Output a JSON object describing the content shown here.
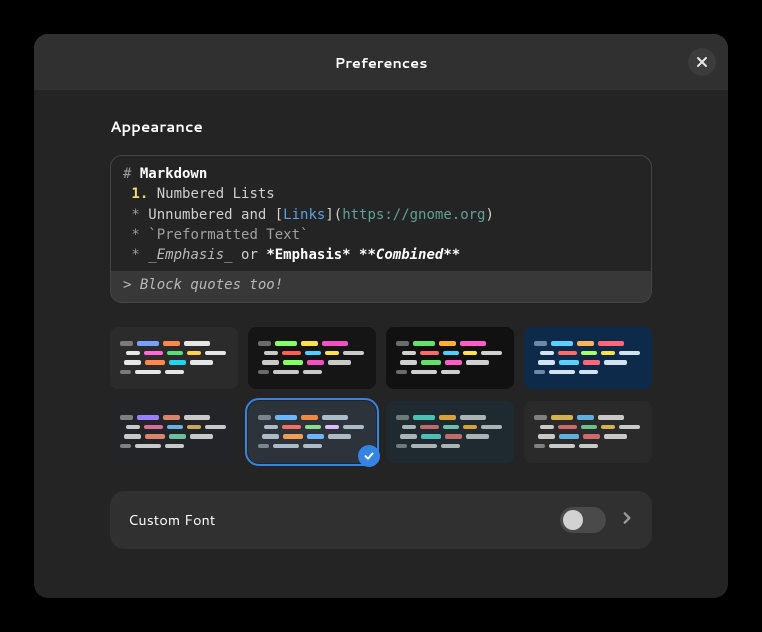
{
  "header": {
    "title": "Preferences"
  },
  "section": {
    "title": "Appearance"
  },
  "preview": {
    "heading_marker": "# ",
    "heading_text": "Markdown",
    "line_num_marker": " 1.",
    "line_num_text": " Numbered Lists",
    "unnum_marker": " * ",
    "unnum_text": "Unnumbered and ",
    "link_open": "[",
    "link_text": "Links",
    "link_mid": "](",
    "link_url": "https://gnome.org",
    "link_close": ")",
    "pre_marker": " * ",
    "pre_text": "`Preformatted Text`",
    "emph_marker": " * ",
    "emph1": "_Emphasis_",
    "emph_or": " or ",
    "emph2": "*Emphasis*",
    "emph_space": " ",
    "emph3": "**Combined**",
    "blockquote": "> Block quotes too!"
  },
  "themes": [
    {
      "id": "theme-1",
      "bg": "#2b2b2b",
      "selected": false,
      "colors": [
        [
          "#7a7a7a",
          "#7aa0ff",
          "#ff884d",
          "#e6e6e6"
        ],
        [
          "#e6e6e6",
          "#ff6ad5",
          "#55e07a",
          "#ffd24d",
          "#e6e6e6"
        ],
        [
          "#e6e6e6",
          "#ff884d",
          "#22d3ee",
          "#e6e6e6"
        ],
        [
          "#7a7a7a",
          "#e6e6e6",
          "#e6e6e6"
        ]
      ]
    },
    {
      "id": "theme-2",
      "bg": "#151515",
      "selected": false,
      "colors": [
        [
          "#6b6b6b",
          "#85ff66",
          "#ffe14d",
          "#f050c0"
        ],
        [
          "#c9c9c9",
          "#ff6050",
          "#4dd0ff",
          "#ffe14d",
          "#c9c9c9"
        ],
        [
          "#c9c9c9",
          "#85ff66",
          "#f050c0",
          "#c9c9c9"
        ],
        [
          "#6b6b6b",
          "#c9c9c9",
          "#c9c9c9"
        ]
      ]
    },
    {
      "id": "theme-3",
      "bg": "#111111",
      "selected": false,
      "colors": [
        [
          "#6b6b6b",
          "#62e06b",
          "#ffb02e",
          "#ff5cc8"
        ],
        [
          "#d0d0d0",
          "#ff6a6a",
          "#4dd0ff",
          "#ffe14d",
          "#d0d0d0"
        ],
        [
          "#d0d0d0",
          "#62e06b",
          "#ff5cc8",
          "#d0d0d0"
        ],
        [
          "#6b6b6b",
          "#d0d0d0",
          "#d0d0d0"
        ]
      ]
    },
    {
      "id": "theme-4",
      "bg": "#0d2a4a",
      "selected": false,
      "colors": [
        [
          "#6b89a8",
          "#5ad1ff",
          "#ffb259",
          "#ff6678"
        ],
        [
          "#d3e2f0",
          "#ff6a6a",
          "#a8ff6a",
          "#ffe14d",
          "#d3e2f0"
        ],
        [
          "#d3e2f0",
          "#5ad1ff",
          "#ff6678",
          "#d3e2f0"
        ],
        [
          "#6b89a8",
          "#d3e2f0",
          "#d3e2f0"
        ]
      ]
    },
    {
      "id": "theme-5",
      "bg": "#232427",
      "selected": false,
      "colors": [
        [
          "#808080",
          "#9a7fff",
          "#d9846b",
          "#c8c8c8"
        ],
        [
          "#c8c8c8",
          "#d56f9c",
          "#6ab0e0",
          "#c9a95e",
          "#c8c8c8"
        ],
        [
          "#c8c8c8",
          "#d9846b",
          "#6ac29e",
          "#c8c8c8"
        ],
        [
          "#808080",
          "#c8c8c8",
          "#c8c8c8"
        ]
      ]
    },
    {
      "id": "theme-6",
      "bg": "#2d333b",
      "selected": true,
      "colors": [
        [
          "#7b8591",
          "#6cb6ff",
          "#f0883e",
          "#adbac7"
        ],
        [
          "#adbac7",
          "#f47067",
          "#8ddb8c",
          "#dcbdfb",
          "#adbac7"
        ],
        [
          "#adbac7",
          "#f69d50",
          "#6cb6ff",
          "#adbac7"
        ],
        [
          "#7b8591",
          "#adbac7",
          "#adbac7"
        ]
      ]
    },
    {
      "id": "theme-7",
      "bg": "#1f2a30",
      "selected": false,
      "colors": [
        [
          "#6b7b7b",
          "#4dc0b5",
          "#d6a23a",
          "#aab4b4"
        ],
        [
          "#aab4b4",
          "#c06a6a",
          "#6ac2a8",
          "#d6a23a",
          "#aab4b4"
        ],
        [
          "#aab4b4",
          "#4dc0b5",
          "#c06a6a",
          "#aab4b4"
        ],
        [
          "#6b7b7b",
          "#aab4b4",
          "#aab4b4"
        ]
      ]
    },
    {
      "id": "theme-8",
      "bg": "#2a2a2a",
      "selected": false,
      "colors": [
        [
          "#808080",
          "#d4b250",
          "#5fb0e0",
          "#c9c9c9"
        ],
        [
          "#c9c9c9",
          "#cf6a6a",
          "#6ac28a",
          "#d4b250",
          "#c9c9c9"
        ],
        [
          "#c9c9c9",
          "#5fb0e0",
          "#cf6a6a",
          "#c9c9c9"
        ],
        [
          "#808080",
          "#c9c9c9",
          "#c9c9c9"
        ]
      ]
    }
  ],
  "custom_font": {
    "label": "Custom Font",
    "enabled": false
  }
}
